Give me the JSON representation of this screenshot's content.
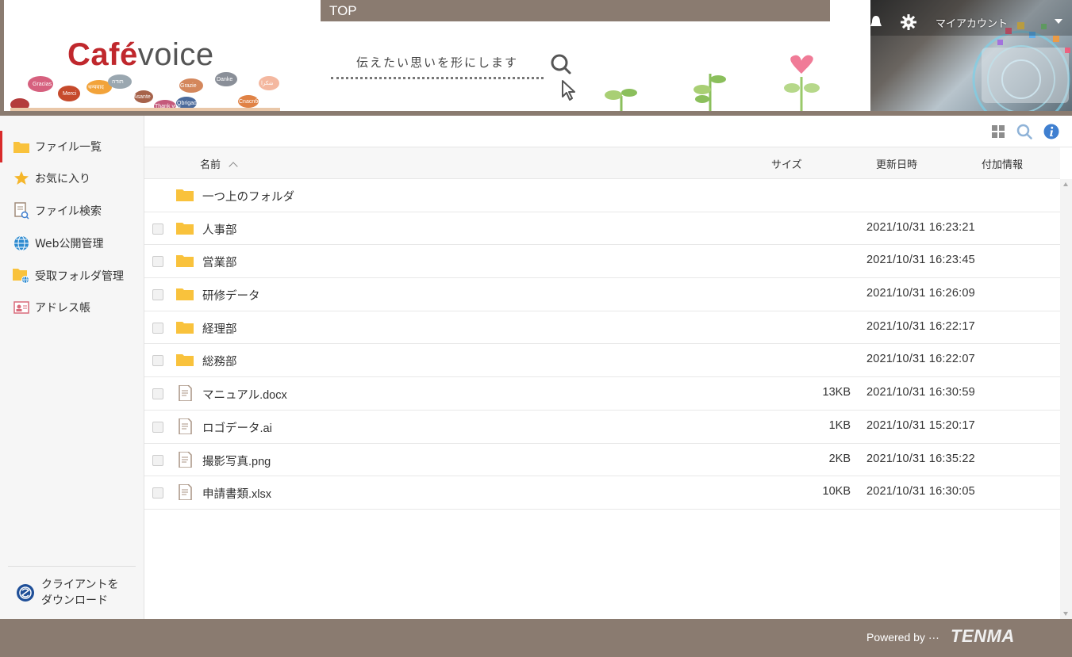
{
  "header": {
    "top_label": "TOP",
    "logo_part1": "Café",
    "logo_part2": "voice",
    "tagline": "伝えたい思いを形にします",
    "account_label": "マイアカウント",
    "bubble_words": [
      "Gracias",
      "Merci",
      "Grazie",
      "Danke",
      "Asante",
      "Thank you",
      "Obrigado",
      "Cnacnбo",
      "شكرا",
      "धन्यवाद",
      "תודה"
    ]
  },
  "sidebar": {
    "items": [
      {
        "label": "ファイル一覧",
        "icon": "folder-icon",
        "active": true
      },
      {
        "label": "お気に入り",
        "icon": "star-icon",
        "active": false
      },
      {
        "label": "ファイル検索",
        "icon": "file-search-icon",
        "active": false
      },
      {
        "label": "Web公開管理",
        "icon": "globe-icon",
        "active": false
      },
      {
        "label": "受取フォルダ管理",
        "icon": "folder-globe-icon",
        "active": false
      },
      {
        "label": "アドレス帳",
        "icon": "address-card-icon",
        "active": false
      }
    ],
    "download_line1": "クライアントを",
    "download_line2": "ダウンロード"
  },
  "toolbar": {
    "icons": [
      "grid-view-icon",
      "search-icon",
      "info-icon"
    ]
  },
  "list": {
    "columns": {
      "name": "名前",
      "size": "サイズ",
      "modified": "更新日時",
      "extra": "付加情報"
    },
    "parent_folder_label": "一つ上のフォルダ",
    "rows": [
      {
        "type": "folder",
        "name": "人事部",
        "size": "",
        "date": "2021/10/31 16:23:21"
      },
      {
        "type": "folder",
        "name": "営業部",
        "size": "",
        "date": "2021/10/31 16:23:45"
      },
      {
        "type": "folder",
        "name": "研修データ",
        "size": "",
        "date": "2021/10/31 16:26:09"
      },
      {
        "type": "folder",
        "name": "経理部",
        "size": "",
        "date": "2021/10/31 16:22:17"
      },
      {
        "type": "folder",
        "name": "総務部",
        "size": "",
        "date": "2021/10/31 16:22:07"
      },
      {
        "type": "file",
        "name": "マニュアル.docx",
        "size": "13KB",
        "date": "2021/10/31 16:30:59"
      },
      {
        "type": "file",
        "name": "ロゴデータ.ai",
        "size": "1KB",
        "date": "2021/10/31 15:20:17"
      },
      {
        "type": "file",
        "name": "撮影写真.png",
        "size": "2KB",
        "date": "2021/10/31 16:35:22"
      },
      {
        "type": "file",
        "name": "申請書類.xlsx",
        "size": "10KB",
        "date": "2021/10/31 16:30:05"
      }
    ]
  },
  "footer": {
    "powered_by": "Powered by ···",
    "brand": "TENMA"
  },
  "colors": {
    "brand_brown": "#8a7b70",
    "logo_red": "#c0282d",
    "active_red": "#d92b2b",
    "folder_yellow": "#f9c23c",
    "info_blue": "#3f7fd0"
  }
}
